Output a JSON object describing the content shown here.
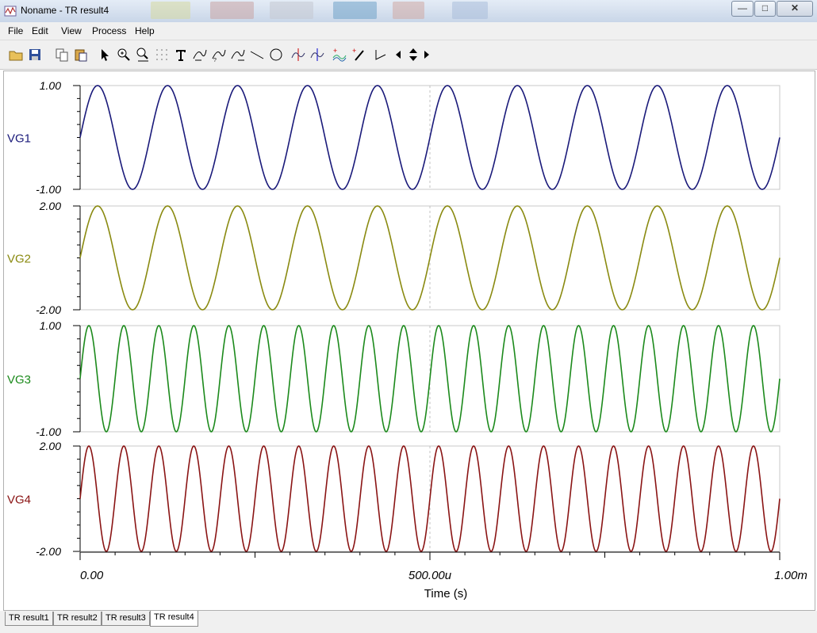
{
  "window": {
    "title": "Noname - TR result4"
  },
  "menu": [
    "File",
    "Edit",
    "View",
    "Process",
    "Help"
  ],
  "toolbar_icons": [
    "open-folder-icon",
    "save-icon",
    "copy-icon",
    "paste-icon",
    "pointer-icon",
    "zoom-in-icon",
    "zoom-100-icon",
    "grid-icon",
    "text-icon",
    "curve-label-a-icon",
    "curve-label-b-icon",
    "curve-label-c-icon",
    "line-icon",
    "circle-icon",
    "cursor-a-icon",
    "cursor-b-icon",
    "add-curve-icon",
    "pen-add-icon",
    "step-icon",
    "arrow-left-icon",
    "arrow-updown-icon",
    "arrow-right-icon"
  ],
  "tabs": [
    "TR result1",
    "TR result2",
    "TR result3",
    "TR result4"
  ],
  "active_tab": 3,
  "chart_data": {
    "type": "line",
    "xlabel": "Time (s)",
    "x_ticks": [
      "0.00",
      "500.00u",
      "1.00m"
    ],
    "xlim": [
      0,
      0.001
    ],
    "grid": false,
    "series": [
      {
        "name": "VG1",
        "color": "#1a1a7a",
        "amplitude": 1,
        "frequency_hz": 10000,
        "ylim": [
          -1,
          1
        ],
        "y_ticks": [
          "1.00",
          "-1.00"
        ]
      },
      {
        "name": "VG2",
        "color": "#8a8a10",
        "amplitude": 2,
        "frequency_hz": 10000,
        "ylim": [
          -2,
          2
        ],
        "y_ticks": [
          "2.00",
          "-2.00"
        ]
      },
      {
        "name": "VG3",
        "color": "#1c8a1c",
        "amplitude": 1,
        "frequency_hz": 20000,
        "ylim": [
          -1,
          1
        ],
        "y_ticks": [
          "1.00",
          "-1.00"
        ]
      },
      {
        "name": "VG4",
        "color": "#8a1414",
        "amplitude": 2,
        "frequency_hz": 20000,
        "ylim": [
          -2,
          2
        ],
        "y_ticks": [
          "2.00",
          "-2.00"
        ]
      }
    ]
  }
}
